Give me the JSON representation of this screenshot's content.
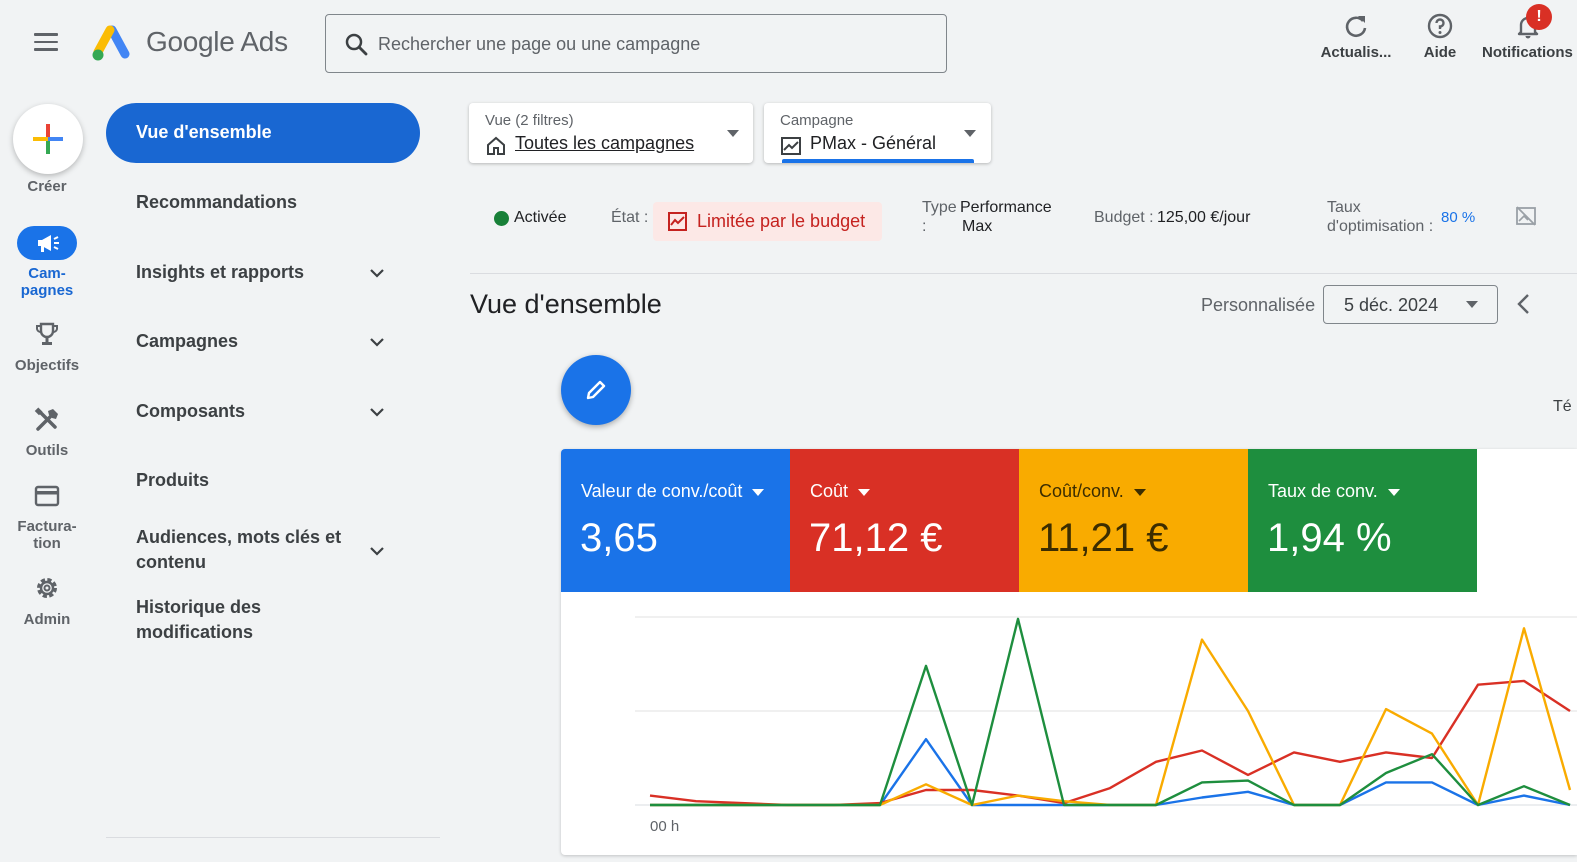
{
  "app": {
    "logo_text": "Google Ads"
  },
  "search": {
    "placeholder": "Rechercher une page ou une campagne"
  },
  "topbar": {
    "refresh_label": "Actualis...",
    "help_label": "Aide",
    "notifications_label": "Notifications",
    "notifications_badge": "!"
  },
  "rail": {
    "create_label": "Créer",
    "campaigns_label_1": "Cam-",
    "campaigns_label_2": "pagnes",
    "goals_label": "Objectifs",
    "tools_label": "Outils",
    "billing_label_1": "Factura-",
    "billing_label_2": "tion",
    "admin_label": "Admin"
  },
  "nav": {
    "overview": "Vue d'ensemble",
    "recommendations": "Recommandations",
    "insights": "Insights et rapports",
    "campaigns": "Campagnes",
    "assets": "Composants",
    "products": "Produits",
    "audiences_1": "Audiences, mots clés et",
    "audiences_2": "contenu",
    "history_1": "Historique des",
    "history_2": "modifications"
  },
  "filters": {
    "view_label": "Vue (2 filtres)",
    "view_value": "Toutes les campagnes",
    "campaign_label": "Campagne",
    "campaign_value": "PMax - Général"
  },
  "status": {
    "enabled": "Activée",
    "state_label": "État :",
    "state_value": "Limitée par le budget",
    "type_label_1": "Type",
    "type_label_2": ":",
    "type_value_1": "Performance",
    "type_value_2": "Max",
    "budget_label": "Budget :",
    "budget_value": "125,00 €/jour",
    "optim_label_1": "Taux",
    "optim_label_2": "d'optimisation :",
    "optim_value": "80 %"
  },
  "page": {
    "title": "Vue d'ensemble",
    "custom_label": "Personnalisée",
    "date_value": "5 déc. 2024",
    "clipped_text": "Té"
  },
  "metrics": [
    {
      "label": "Valeur de conv./coût",
      "value": "3,65",
      "color": "#1a73e8"
    },
    {
      "label": "Coût",
      "value": "71,12 €",
      "color": "#d93025"
    },
    {
      "label": "Coût/conv.",
      "value": "11,21 €",
      "color": "#f9ab00"
    },
    {
      "label": "Taux de conv.",
      "value": "1,94 %",
      "color": "#1e8e3e"
    }
  ],
  "chart_data": {
    "type": "line",
    "x_tick_label": "00 h",
    "series": [
      {
        "color": "#1a73e8",
        "values": [
          0,
          0,
          0,
          0,
          0,
          0,
          35,
          0,
          0,
          0,
          0,
          0,
          4,
          7,
          0,
          0,
          12,
          12,
          0,
          5,
          0
        ]
      },
      {
        "color": "#d93025",
        "values": [
          5,
          2,
          1,
          0,
          0,
          1,
          8,
          8,
          5,
          1,
          9,
          23,
          29,
          16,
          28,
          23,
          28,
          25,
          64,
          66,
          50
        ]
      },
      {
        "color": "#f9ab00",
        "values": [
          0,
          0,
          0,
          0,
          0,
          0,
          11,
          0,
          5,
          2,
          0,
          0,
          88,
          50,
          0,
          0,
          51,
          38,
          0,
          94,
          8
        ]
      },
      {
        "color": "#1e8e3e",
        "values": [
          0,
          0,
          0,
          0,
          0,
          0,
          74,
          0,
          99,
          0,
          0,
          0,
          12,
          13,
          0,
          0,
          17,
          27,
          0,
          10,
          0
        ]
      }
    ]
  }
}
